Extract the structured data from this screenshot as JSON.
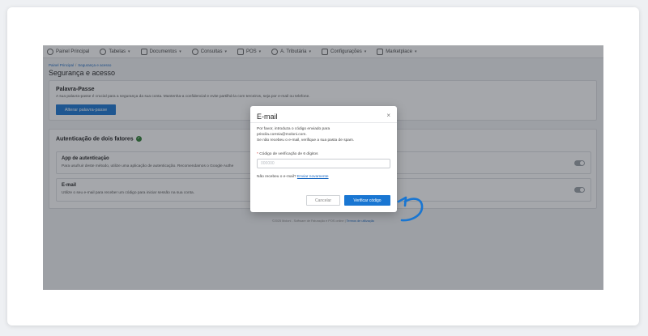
{
  "nav": {
    "items": [
      {
        "label": "Painel Principal",
        "icon": "dashboard-icon",
        "has_menu": false
      },
      {
        "label": "Tabelas",
        "icon": "people-icon",
        "has_menu": true
      },
      {
        "label": "Documentos",
        "icon": "document-icon",
        "has_menu": true
      },
      {
        "label": "Consultas",
        "icon": "search-icon",
        "has_menu": true
      },
      {
        "label": "POS",
        "icon": "pos-icon",
        "has_menu": true
      },
      {
        "label": "A. Tributária",
        "icon": "tax-icon",
        "has_menu": true
      },
      {
        "label": "Configurações",
        "icon": "settings-icon",
        "has_menu": true
      },
      {
        "label": "Marketplace",
        "icon": "marketplace-icon",
        "has_menu": true
      }
    ],
    "chevron": "▾"
  },
  "breadcrumb": {
    "root": "Painel Principal",
    "separator": "/",
    "current": "Segurança e acesso"
  },
  "page_title": "Segurança e acesso",
  "password_card": {
    "title": "Palavra-Passe",
    "description": "A sua palavra-passe é crucial para a segurança da sua conta. Mantenha-a confidencial e evite partilhá-la com terceiros, seja por e-mail ou telefone.",
    "button_label": "Alterar palavra-passe"
  },
  "twofa_card": {
    "title": "Autenticação de dois fatores",
    "status_icon": "check-circle-icon",
    "options": [
      {
        "title": "App de autenticação",
        "description": "Para usufruir deste método, utilize uma aplicação de autenticação. Recomendamos o Google Authe",
        "enabled": false
      },
      {
        "title": "E-mail",
        "description": "Utilize o seu e-mail para receber um código para iniciar sessão na sua conta.",
        "enabled": false
      }
    ]
  },
  "footer": {
    "text": "©2025 Moloni - Software de Faturação e POS online |",
    "link": "Termos de utilização"
  },
  "modal": {
    "title": "E-mail",
    "close_glyph": "×",
    "line1": "Por favor, introduza o código enviado para",
    "email": "priscila.correia@moloni.com.",
    "line3": "Se não recebeu o e-mail, verifique a sua pasta de spam.",
    "required_mark": "*",
    "field_label": "Código de verificação de 6 dígitos",
    "input_value": "",
    "input_placeholder": "000000",
    "resend_prompt": "Não recebeu o e-mail?",
    "resend_link": "Enviar novamente",
    "cancel_label": "Cancelar",
    "verify_label": "Verificar código"
  },
  "colors": {
    "primary": "#1976d2",
    "success": "#2e7d32",
    "overlay": "rgba(40,45,55,0.42)"
  }
}
